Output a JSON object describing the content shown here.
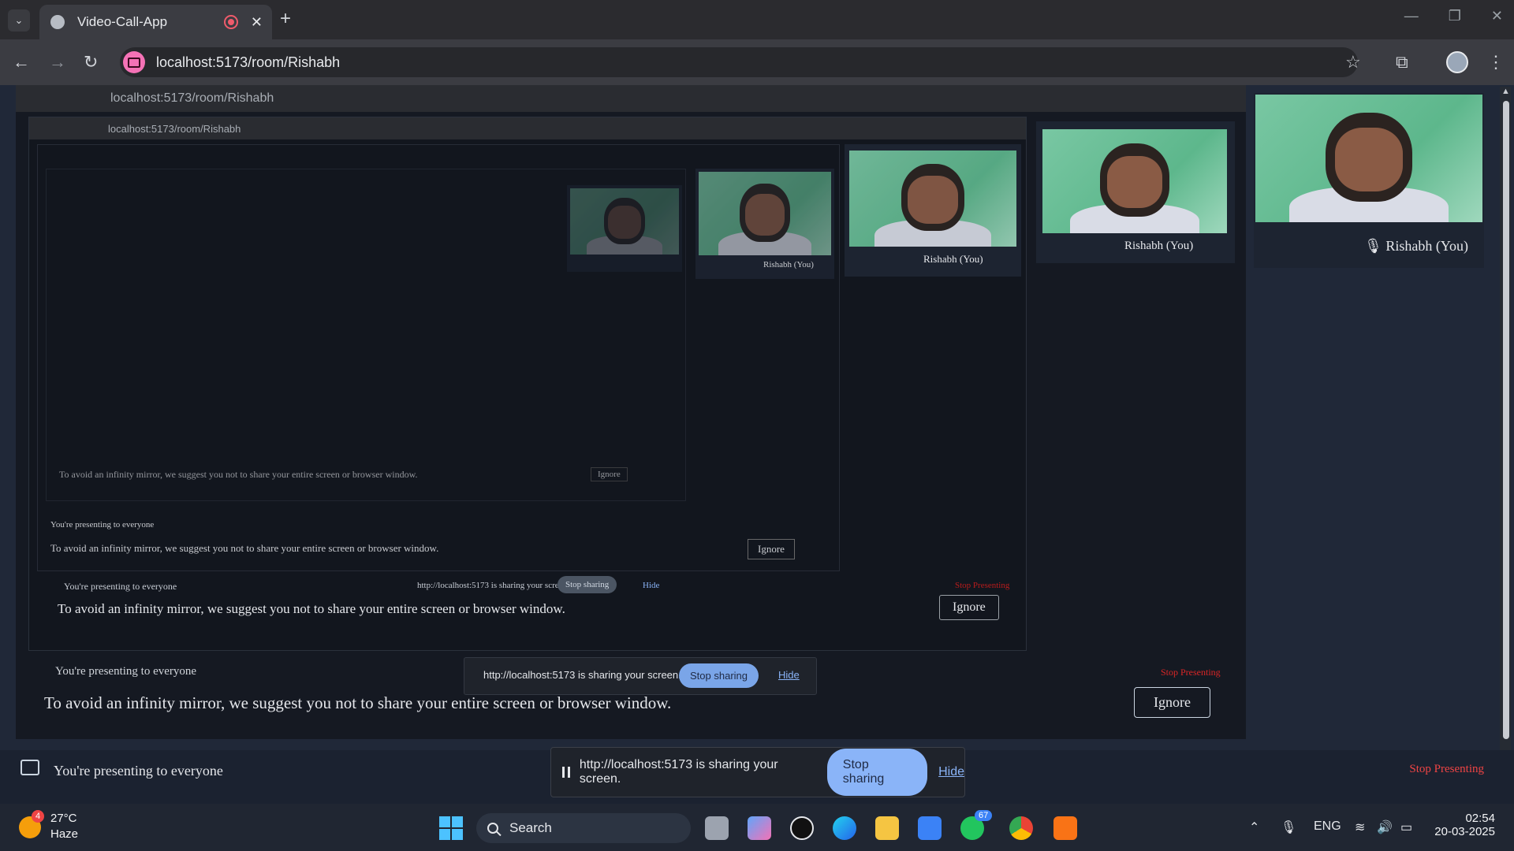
{
  "browser": {
    "tab_title": "Video-Call-App",
    "tab_close": "✕",
    "new_tab": "+",
    "url": "localhost:5173/room/Rishabh"
  },
  "tiles": {
    "self_name": "Rishabh (You)"
  },
  "mirror": {
    "infinity_warning": "To avoid an infinity mirror, we suggest you not to share your entire screen or browser window.",
    "ignore_label": "Ignore",
    "presenting_text": "You're presenting to everyone",
    "stop_presenting": "Stop Presenting",
    "sharing_msg": "http://localhost:5173 is sharing your screen.",
    "stop_sharing": "Stop sharing",
    "hide": "Hide"
  },
  "presenting_bar": {
    "text": "You're presenting to everyone",
    "stop_presenting": "Stop Presenting"
  },
  "share_popup": {
    "message": "http://localhost:5173 is sharing your screen.",
    "stop_sharing": "Stop sharing",
    "hide": "Hide"
  },
  "taskbar": {
    "weather_badge": "4",
    "temperature": "27°C",
    "condition": "Haze",
    "search_label": "Search",
    "whatsapp_badge": "67",
    "lang": "ENG",
    "time": "02:54",
    "date": "20-03-2025"
  },
  "colors": {
    "accent_blue": "#8ab4f8",
    "stop_red": "#ef4444",
    "record_pink": "#ef5b6b"
  }
}
